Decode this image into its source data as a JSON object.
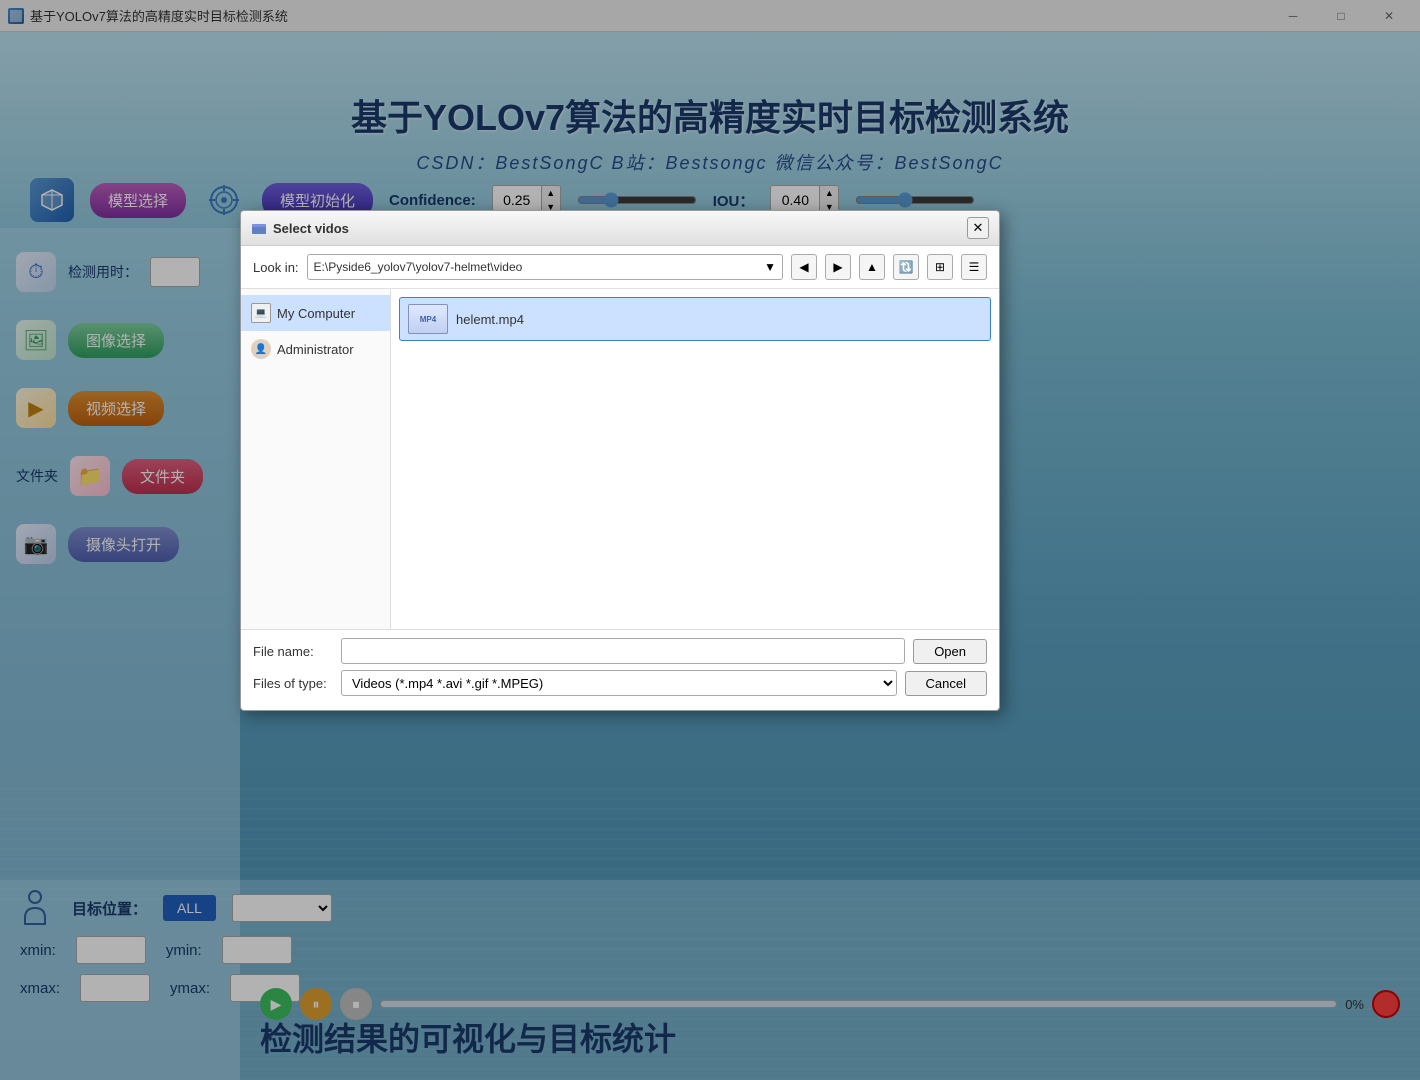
{
  "app": {
    "title": "基于YOLOv7算法的高精度实时目标检测系统",
    "title_main": "基于YOLOv7算法的高精度实时目标检测系统",
    "subtitle": "CSDN：BestSongC  B站：Bestsongc  微信公众号：BestSongC"
  },
  "toolbar": {
    "model_select_label": "模型选择",
    "model_init_label": "模型初始化",
    "confidence_label": "Confidence:",
    "confidence_value": "0.25",
    "iou_label": "IOU：",
    "iou_value": "0.40"
  },
  "sidebar": {
    "detect_time_label": "检测用时：",
    "image_select_label": "图像选择",
    "video_select_label": "视频选择",
    "folder_label": "文件夹",
    "folder_btn_label": "文件夹",
    "camera_btn_label": "摄像头打开"
  },
  "bottom": {
    "target_position_label": "目标位置：",
    "all_btn_label": "ALL",
    "xmin_label": "xmin:",
    "ymin_label": "ymin:",
    "xmax_label": "xmax:",
    "ymax_label": "ymax:",
    "progress_pct": "0%",
    "overlay_text": "检测结果的可视化与目标统计"
  },
  "dialog": {
    "title": "Select vidos",
    "look_in_label": "Look in:",
    "path": "E:\\Pyside6_yolov7\\yolov7-helmet\\video",
    "tree_items": [
      {
        "name": "My Computer",
        "type": "computer"
      },
      {
        "name": "Administrator",
        "type": "user"
      }
    ],
    "files": [
      {
        "name": "helemt.mp4",
        "type": "mp4"
      }
    ],
    "file_name_label": "File name:",
    "file_name_value": "",
    "files_of_type_label": "Files of type:",
    "files_of_type_value": "Videos (*.mp4 *.avi *.gif *.MPEG)",
    "open_btn": "Open",
    "cancel_btn": "Cancel"
  },
  "titlebar": {
    "app_name": "基于YOLOv7算法的高精度实时目标检测系统",
    "minimize": "─",
    "maximize": "□",
    "close": "✕"
  }
}
